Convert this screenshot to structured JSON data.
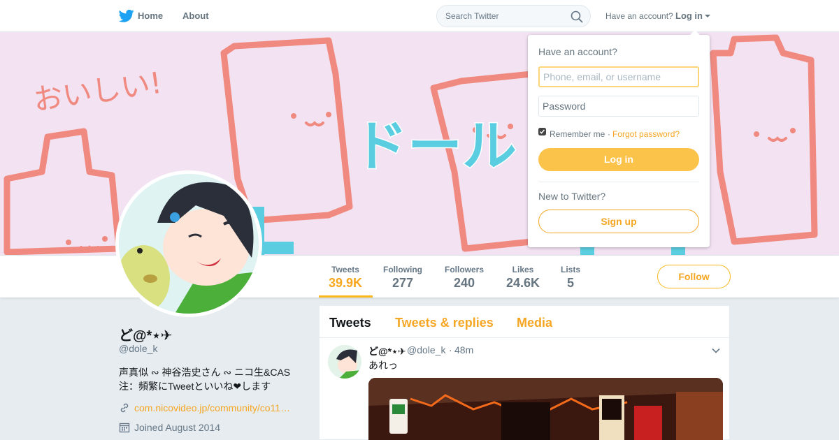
{
  "nav": {
    "home_label": "Home",
    "about_label": "About",
    "search_placeholder": "Search Twitter",
    "have_account": "Have an account?",
    "login_label": "Log in"
  },
  "profile": {
    "name": "ど@*⋆✈",
    "handle": "@dole_k",
    "bio_line1": "声真似 ∾ 神谷浩史さん ∾ ニコ生&CAS",
    "bio_line2": "注：頻繁にTweetといいね❤︎します",
    "link": "com.nicovideo.jp/community/co11…",
    "joined": "Joined August 2014"
  },
  "stats": [
    {
      "label": "Tweets",
      "value": "39.9K"
    },
    {
      "label": "Following",
      "value": "277"
    },
    {
      "label": "Followers",
      "value": "240"
    },
    {
      "label": "Likes",
      "value": "24.6K"
    },
    {
      "label": "Lists",
      "value": "5"
    }
  ],
  "follow_label": "Follow",
  "timeline": {
    "tabs": [
      "Tweets",
      "Tweets & replies",
      "Media"
    ],
    "tweet": {
      "name": "ど@*⋆✈",
      "handle": "@dole_k",
      "dot": "·",
      "time": "48m",
      "text": "あれっ"
    }
  },
  "login_dropdown": {
    "title": "Have an account?",
    "username_placeholder": "Phone, email, or username",
    "password_placeholder": "Password",
    "remember": "Remember me",
    "separator": "·",
    "forgot": "Forgot password?",
    "login_button": "Log in",
    "new_to_twitter": "New to Twitter?",
    "signup_button": "Sign up"
  },
  "banner_text": [
    "おいしい!",
    "ドール"
  ],
  "colors": {
    "accent": "#f5a623",
    "twitter_blue": "#1da1f2",
    "banner_bg": "#f2e2f2"
  }
}
